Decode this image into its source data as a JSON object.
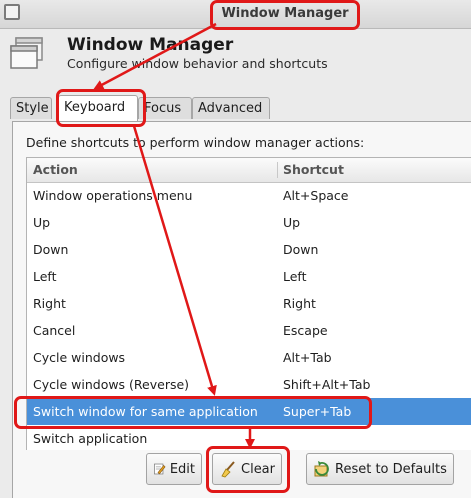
{
  "window": {
    "title": "Window Manager"
  },
  "header": {
    "title": "Window Manager",
    "subtitle": "Configure window behavior and shortcuts"
  },
  "tabs": [
    {
      "label": "Style",
      "active": false
    },
    {
      "label": "Keyboard",
      "active": true
    },
    {
      "label": "Focus",
      "active": false
    },
    {
      "label": "Advanced",
      "active": false
    }
  ],
  "keyboard": {
    "description": "Define shortcuts to perform window manager actions:",
    "columns": {
      "action": "Action",
      "shortcut": "Shortcut"
    },
    "rows": [
      {
        "action": "Window operations menu",
        "shortcut": "Alt+Space"
      },
      {
        "action": "Up",
        "shortcut": "Up"
      },
      {
        "action": "Down",
        "shortcut": "Down"
      },
      {
        "action": "Left",
        "shortcut": "Left"
      },
      {
        "action": "Right",
        "shortcut": "Right"
      },
      {
        "action": "Cancel",
        "shortcut": "Escape"
      },
      {
        "action": "Cycle windows",
        "shortcut": "Alt+Tab"
      },
      {
        "action": "Cycle windows (Reverse)",
        "shortcut": "Shift+Alt+Tab"
      },
      {
        "action": "Switch window for same application",
        "shortcut": "Super+Tab"
      },
      {
        "action": "Switch application",
        "shortcut": ""
      }
    ],
    "selected_row": "Switch window for same application"
  },
  "buttons": {
    "edit": "Edit",
    "clear": "Clear",
    "reset": "Reset to Defaults"
  },
  "colors": {
    "selection": "#4a90d9",
    "annotation": "#e01818"
  },
  "icons": {
    "header": "window-manager-icon",
    "edit": "edit-icon",
    "clear": "broom-icon",
    "reset": "reset-icon"
  }
}
